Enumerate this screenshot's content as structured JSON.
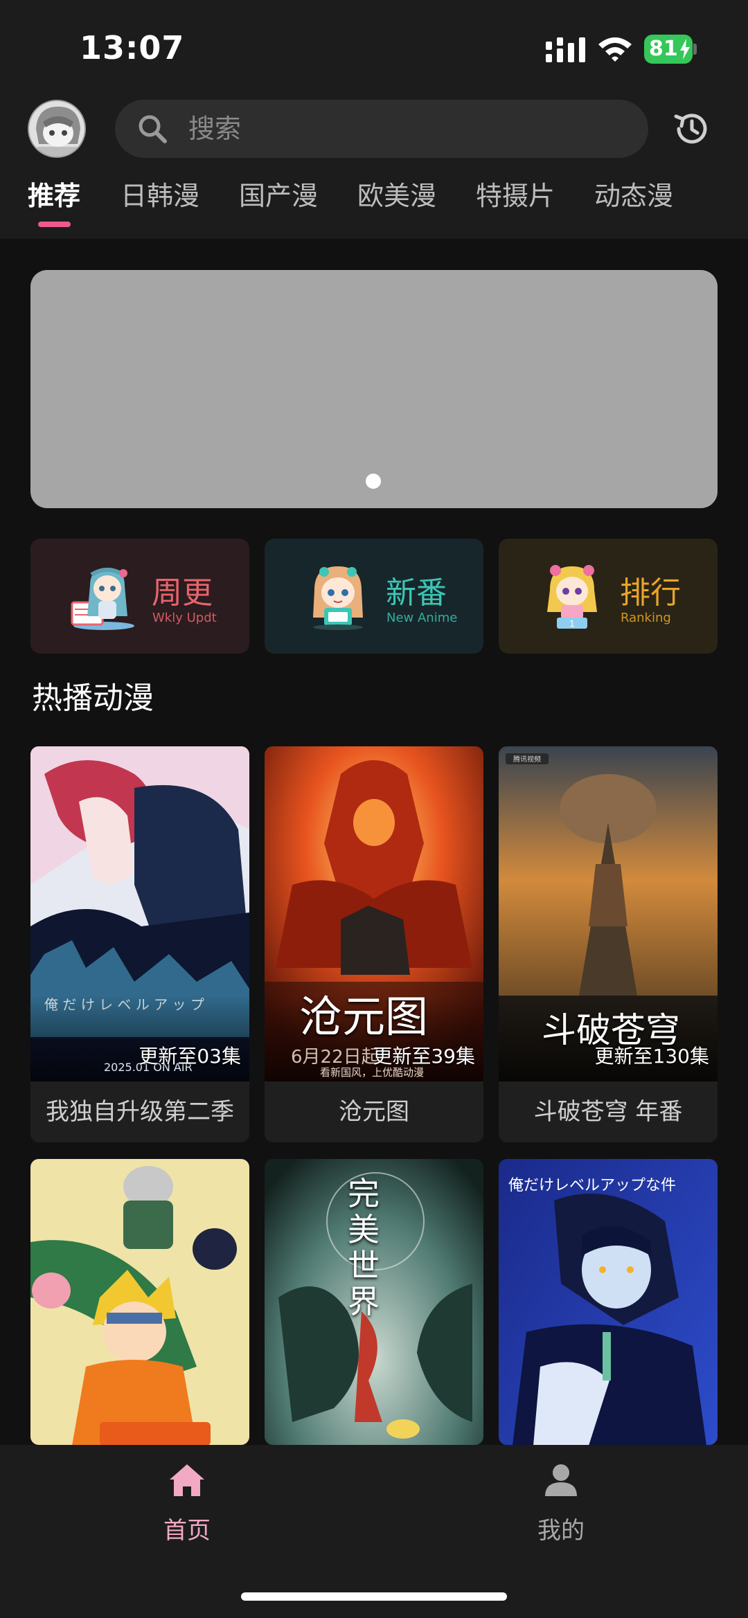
{
  "status_bar": {
    "time": "13:07",
    "battery": "81"
  },
  "header": {
    "search": {
      "placeholder": "搜索"
    },
    "tabs": [
      {
        "label": "推荐",
        "active": true
      },
      {
        "label": "日韩漫"
      },
      {
        "label": "国产漫"
      },
      {
        "label": "欧美漫"
      },
      {
        "label": "特摄片"
      },
      {
        "label": "动态漫"
      }
    ],
    "accent_color": "#ec5a8c"
  },
  "banner": {
    "page_count": 1,
    "active_page": 1
  },
  "quick_entries": [
    {
      "title": "周更",
      "subtitle": "Wkly Updt",
      "color": "#e8646b",
      "bg": "#2a1c1f"
    },
    {
      "title": "新番",
      "subtitle": "New Anime",
      "color": "#3cc6b6",
      "bg": "#17262a"
    },
    {
      "title": "排行",
      "subtitle": "Ranking",
      "color": "#e8a52a",
      "bg": "#2a2416"
    }
  ],
  "hot_section": {
    "title": "热播动漫",
    "items": [
      {
        "title": "我独自升级第二季",
        "episode": "更新至03集",
        "poster_text": "2025.01 ON AIR"
      },
      {
        "title": "沧元图",
        "episode": "更新至39集",
        "poster_text": "沧元图",
        "poster_text2": "6月22日起",
        "poster_text3": "看新国风，上优酷动漫"
      },
      {
        "title": "斗破苍穹 年番",
        "episode": "更新至130集",
        "poster_text": "斗破苍穹"
      },
      {
        "title": "",
        "episode": "",
        "poster_text": ""
      },
      {
        "title": "",
        "episode": "",
        "poster_text": "完美世界"
      },
      {
        "title": "",
        "episode": "",
        "poster_text": "俺だけレベルアップな件"
      }
    ]
  },
  "bottom_nav": [
    {
      "label": "首页",
      "active": true,
      "icon": "home-icon"
    },
    {
      "label": "我的",
      "active": false,
      "icon": "user-icon"
    }
  ]
}
